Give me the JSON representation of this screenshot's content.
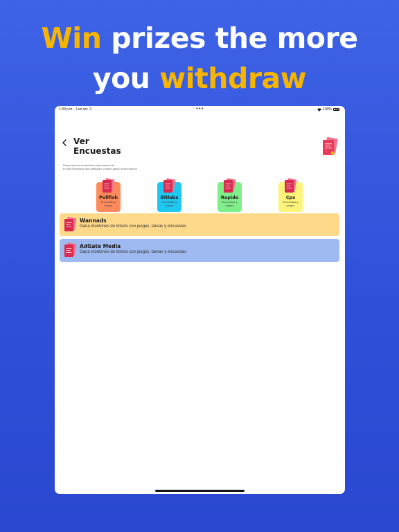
{
  "headline": {
    "part1_highlight": "Win",
    "part1_rest": " prizes the more",
    "part2_start": "you ",
    "part2_highlight": "withdraw"
  },
  "status_bar": {
    "time": "1:39 p.m.",
    "date": "Lun oct. 2",
    "dots": "•••",
    "battery": "100%"
  },
  "header": {
    "title_line1": "Ver",
    "title_line2": "Encuestas",
    "back_icon": "chevron-left-icon",
    "icon": "survey-document-icon"
  },
  "description": {
    "line1": "Responde las encuestas cuidadosamente",
    "line2": "En las encuestas que califiques, podrás ganar mucho dinero"
  },
  "providers": [
    {
      "name": "Pollfish",
      "subtitle": "Encuestas y juegos",
      "color": "#ff8a5c"
    },
    {
      "name": "Bitlabs",
      "subtitle": "Encuestas y juegos",
      "color": "#1ec8f0"
    },
    {
      "name": "Rapido",
      "subtitle": "Encuestas y juegos",
      "color": "#7fef8a"
    },
    {
      "name": "Cpx",
      "subtitle": "Encuestas y juegos",
      "color": "#fdf57a"
    }
  ],
  "cards": [
    {
      "title": "Wannads",
      "subtitle": "Gana montones de tickets con juegos, tareas y encuestas",
      "color": "#ffd98a"
    },
    {
      "title": "AdGate Media",
      "subtitle": "Gana montones de tickets con juegos, tareas y encuestas",
      "color": "#9fbaf0"
    }
  ],
  "colors": {
    "background": "#3e63e6",
    "accent": "#f7b500"
  }
}
